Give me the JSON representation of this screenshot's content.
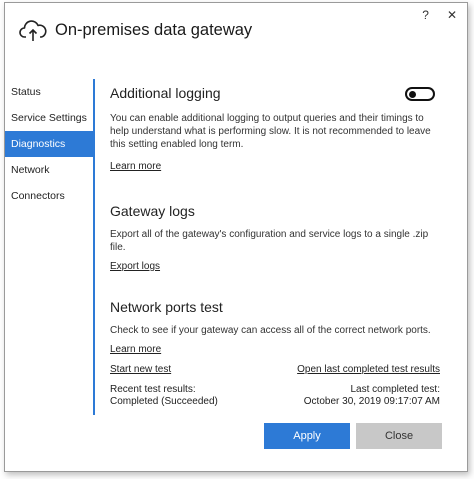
{
  "window": {
    "title": "On-premises data gateway",
    "help_label": "?",
    "close_label": "✕"
  },
  "sidebar": {
    "items": [
      {
        "label": "Status"
      },
      {
        "label": "Service Settings"
      },
      {
        "label": "Diagnostics",
        "active": true
      },
      {
        "label": "Network"
      },
      {
        "label": "Connectors"
      }
    ]
  },
  "additional_logging": {
    "title": "Additional logging",
    "description": "You can enable additional logging to output queries and their timings to help understand what is performing slow. It is not recommended to leave this setting enabled long term.",
    "link": "Learn more",
    "toggle_state": "off"
  },
  "gateway_logs": {
    "title": "Gateway logs",
    "description": "Export all of the gateway's configuration and service logs to a single .zip file.",
    "link": "Export logs"
  },
  "network_ports": {
    "title": "Network ports test",
    "description": "Check to see if your gateway can access all of the correct network ports.",
    "link": "Learn more",
    "start_link": "Start new test",
    "open_link": "Open last completed test results",
    "recent_label": "Recent test results:",
    "recent_value": "Completed (Succeeded)",
    "last_label": "Last completed test:",
    "last_value": "October 30, 2019 09:17:07 AM"
  },
  "buttons": {
    "apply": "Apply",
    "close": "Close"
  },
  "colors": {
    "accent": "#2d7ad6",
    "close_button": "#c8c8c8"
  }
}
